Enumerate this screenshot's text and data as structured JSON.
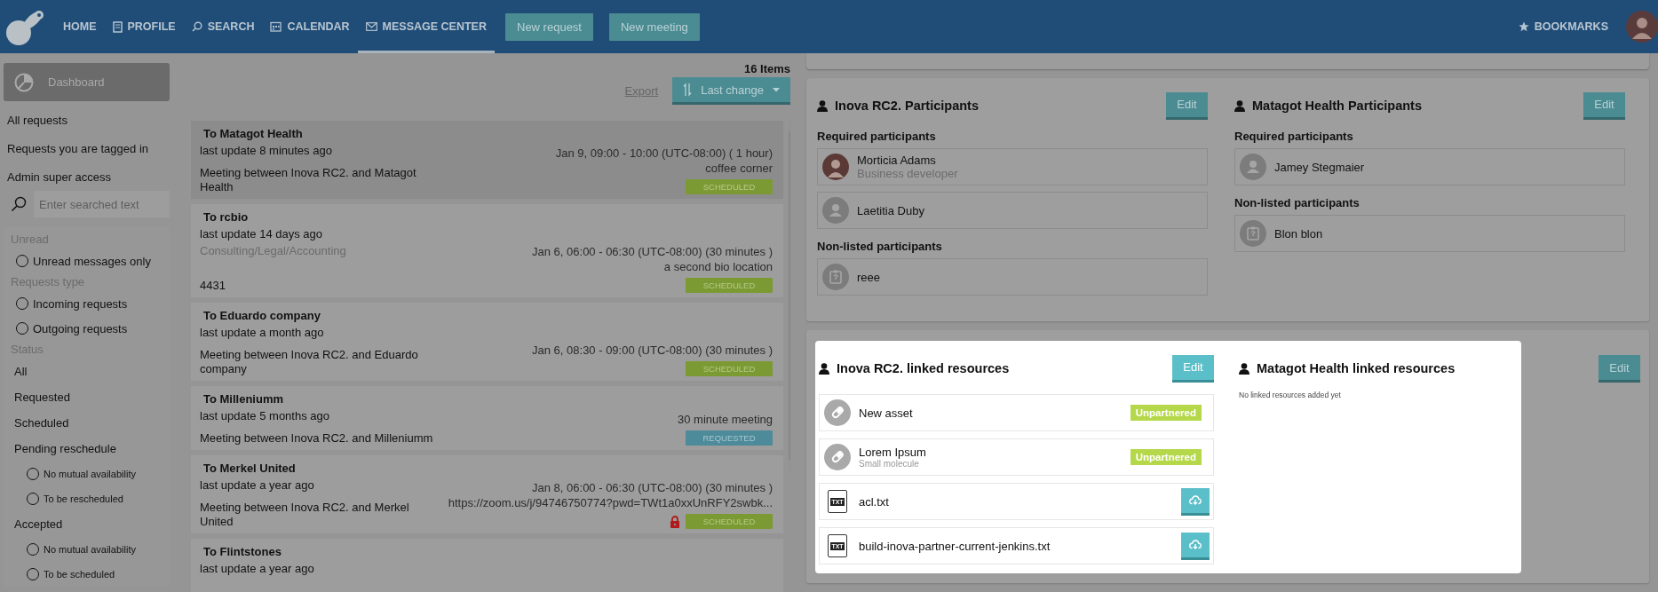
{
  "nav": {
    "items": [
      {
        "label": "HOME",
        "selected": false
      },
      {
        "label": "PROFILE",
        "selected": false
      },
      {
        "label": "SEARCH",
        "selected": false
      },
      {
        "label": "CALENDAR",
        "selected": false
      },
      {
        "label": "MESSAGE CENTER",
        "selected": true
      }
    ],
    "buttons": [
      "New request",
      "New meeting"
    ],
    "bookmarks": "BOOKMARKS"
  },
  "sidebar": {
    "dashboard": "Dashboard",
    "links": [
      "All requests",
      "Requests you are tagged in",
      "Admin super access"
    ],
    "search": {
      "placeholder": "Enter searched text"
    },
    "filters": [
      {
        "kind": "heading",
        "label": "Unread"
      },
      {
        "kind": "radio",
        "label": "Unread messages only",
        "checked": false
      },
      {
        "kind": "heading",
        "label": "Requests type"
      },
      {
        "kind": "radio",
        "label": "Incoming requests",
        "checked": false
      },
      {
        "kind": "radio",
        "label": "Outgoing requests",
        "checked": false
      },
      {
        "kind": "heading",
        "label": "Status"
      },
      {
        "kind": "link",
        "label": "All"
      },
      {
        "kind": "link",
        "label": "Requested"
      },
      {
        "kind": "link",
        "label": "Scheduled"
      },
      {
        "kind": "link",
        "label": "Pending reschedule",
        "children": [
          {
            "kind": "radio",
            "label": "No mutual availability",
            "checked": false
          },
          {
            "kind": "radio",
            "label": "To be rescheduled",
            "checked": false
          }
        ]
      },
      {
        "kind": "link",
        "label": "Accepted",
        "children": [
          {
            "kind": "radio",
            "label": "No mutual availability",
            "checked": false
          },
          {
            "kind": "radio",
            "label": "To be scheduled",
            "checked": false
          }
        ]
      }
    ]
  },
  "requests": {
    "count": "16 Items",
    "export": "Export",
    "sort": "Last change",
    "items": [
      {
        "title": "To Matagot Health",
        "updated": "last update 8 minutes ago",
        "description": "Meeting between Inova RC2. and Matagot Health",
        "details": [
          "Jan 9, 09:00 - 10:00 (UTC-08:00) ( 1 hour)",
          "coffee corner"
        ],
        "status": {
          "label": "SCHEDULED",
          "kind": "scheduled"
        },
        "locked": false,
        "selected": true
      },
      {
        "title": "To rcbio",
        "updated": "last update 14 days ago",
        "category": "Consulting/Legal/Accounting",
        "description": "4431",
        "details": [
          "Jan 6, 06:00 - 06:30 (UTC-08:00) (30 minutes )",
          "a second bio location"
        ],
        "status": {
          "label": "SCHEDULED",
          "kind": "scheduled"
        },
        "locked": false,
        "selected": false
      },
      {
        "title": "To Eduardo company",
        "updated": "last update a month ago",
        "description": "Meeting between Inova RC2. and Eduardo company",
        "details": [
          "Jan 6, 08:30 - 09:00 (UTC-08:00) (30 minutes )"
        ],
        "status": {
          "label": "SCHEDULED",
          "kind": "scheduled"
        },
        "locked": false,
        "selected": false
      },
      {
        "title": "To Milleniumm",
        "updated": "last update 5 months ago",
        "description": "Meeting between Inova RC2. and Milleniumm",
        "details": [
          "30 minute meeting"
        ],
        "status": {
          "label": "REQUESTED",
          "kind": "requested"
        },
        "locked": false,
        "selected": false
      },
      {
        "title": "To Merkel United",
        "updated": "last update a year ago",
        "description": "Meeting between Inova RC2. and Merkel United",
        "details": [
          "Jan 8, 06:00 - 06:30 (UTC-08:00) (30 minutes )",
          "https://zoom.us/j/94746750774?pwd=TWt1a0xxUnRFY2swbk..."
        ],
        "status": {
          "label": "SCHEDULED",
          "kind": "scheduled"
        },
        "locked": true,
        "selected": false
      },
      {
        "title": "To Flintstones",
        "updated": "last update a year ago",
        "selected": false
      }
    ]
  },
  "participants": [
    {
      "title": "Inova RC2. Participants",
      "edit": "Edit",
      "groups": [
        {
          "heading": "Required participants",
          "people": [
            {
              "name": "Morticia Adams",
              "role": "Business developer",
              "kind": "photo"
            },
            {
              "name": "Laetitia Duby",
              "kind": "person"
            }
          ]
        },
        {
          "heading": "Non-listed participants",
          "people": [
            {
              "name": "reee",
              "kind": "unlisted"
            }
          ]
        }
      ]
    },
    {
      "title": "Matagot Health Participants",
      "edit": "Edit",
      "groups": [
        {
          "heading": "Required participants",
          "people": [
            {
              "name": "Jamey Stegmaier",
              "kind": "person"
            }
          ]
        },
        {
          "heading": "Non-listed participants",
          "people": [
            {
              "name": "Blon blon",
              "kind": "unlisted"
            }
          ]
        }
      ]
    }
  ],
  "resources": {
    "spotlight": true,
    "columns": [
      {
        "title": "Inova RC2. linked resources",
        "edit": "Edit",
        "items": [
          {
            "kind": "asset",
            "name": "New asset",
            "tag": "Unpartnered"
          },
          {
            "kind": "asset",
            "name": "Lorem Ipsum",
            "subtitle": "Small molecule",
            "tag": "Unpartnered"
          },
          {
            "kind": "file",
            "name": "acl.txt",
            "icon_label": "TXT"
          },
          {
            "kind": "file",
            "name": "build-inova-partner-current-jenkins.txt",
            "icon_label": "TXT"
          }
        ]
      },
      {
        "title": "Matagot Health linked resources",
        "edit": "Edit",
        "empty_note": "No linked resources added yet"
      }
    ]
  }
}
